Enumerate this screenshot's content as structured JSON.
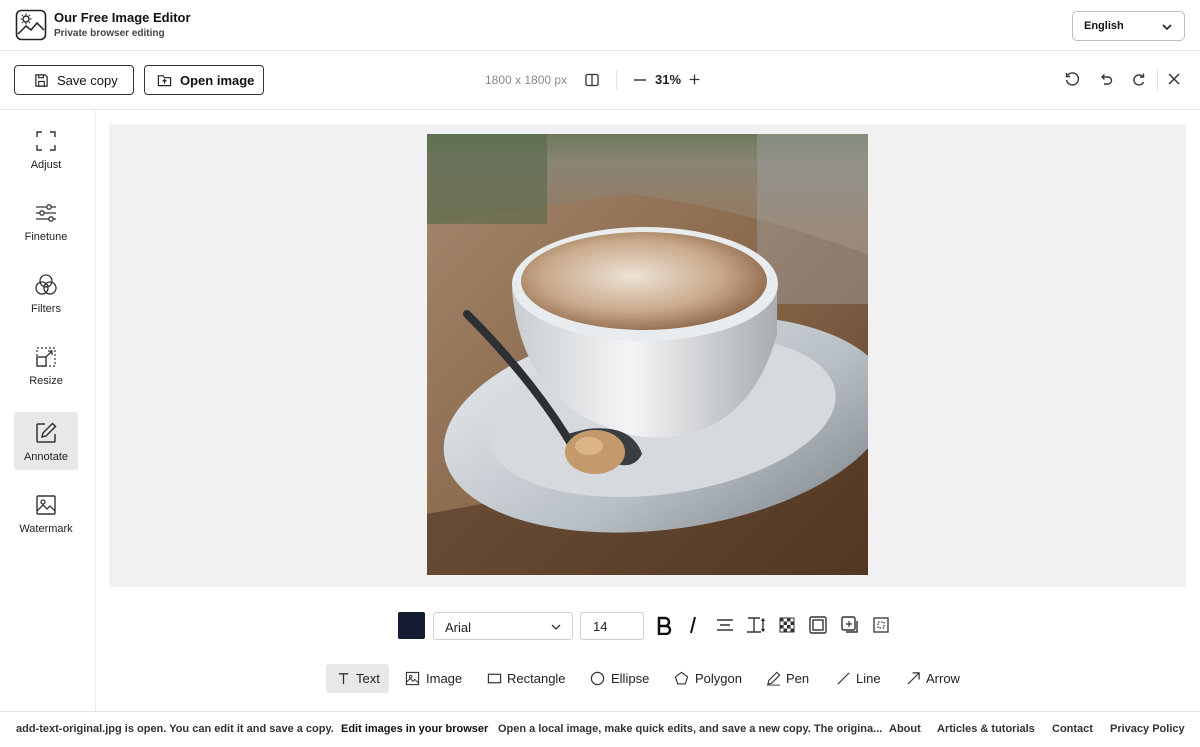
{
  "header": {
    "title": "Our Free Image Editor",
    "subtitle": "Private browser editing",
    "language": "English"
  },
  "toolbar": {
    "save_label": "Save copy",
    "open_label": "Open image",
    "dimensions": "1800 x 1800 px",
    "zoom": "31%"
  },
  "sidebar": {
    "items": [
      {
        "label": "Adjust",
        "icon": "crop-frame-icon"
      },
      {
        "label": "Finetune",
        "icon": "sliders-icon"
      },
      {
        "label": "Filters",
        "icon": "filters-circles-icon"
      },
      {
        "label": "Resize",
        "icon": "resize-icon"
      },
      {
        "label": "Annotate",
        "icon": "pencil-edit-icon",
        "active": true
      },
      {
        "label": "Watermark",
        "icon": "image-icon"
      }
    ]
  },
  "annotate": {
    "color": "#141c33",
    "font": "Arial",
    "font_size": "14"
  },
  "tools": [
    {
      "label": "Text",
      "icon": "text-t-icon",
      "active": true
    },
    {
      "label": "Image",
      "icon": "image-icon"
    },
    {
      "label": "Rectangle",
      "icon": "rectangle-icon"
    },
    {
      "label": "Ellipse",
      "icon": "ellipse-icon"
    },
    {
      "label": "Polygon",
      "icon": "pentagon-icon"
    },
    {
      "label": "Pen",
      "icon": "pen-icon"
    },
    {
      "label": "Line",
      "icon": "line-icon"
    },
    {
      "label": "Arrow",
      "icon": "arrow-icon"
    }
  ],
  "footer": {
    "status": "add-text-original.jpg is open. You can edit it and save a copy.",
    "headline": "Edit images in your browser",
    "description": "Open a local image, make quick edits, and save a new copy. The origina...",
    "links": [
      "About",
      "Articles & tutorials",
      "Contact",
      "Privacy Policy"
    ]
  }
}
